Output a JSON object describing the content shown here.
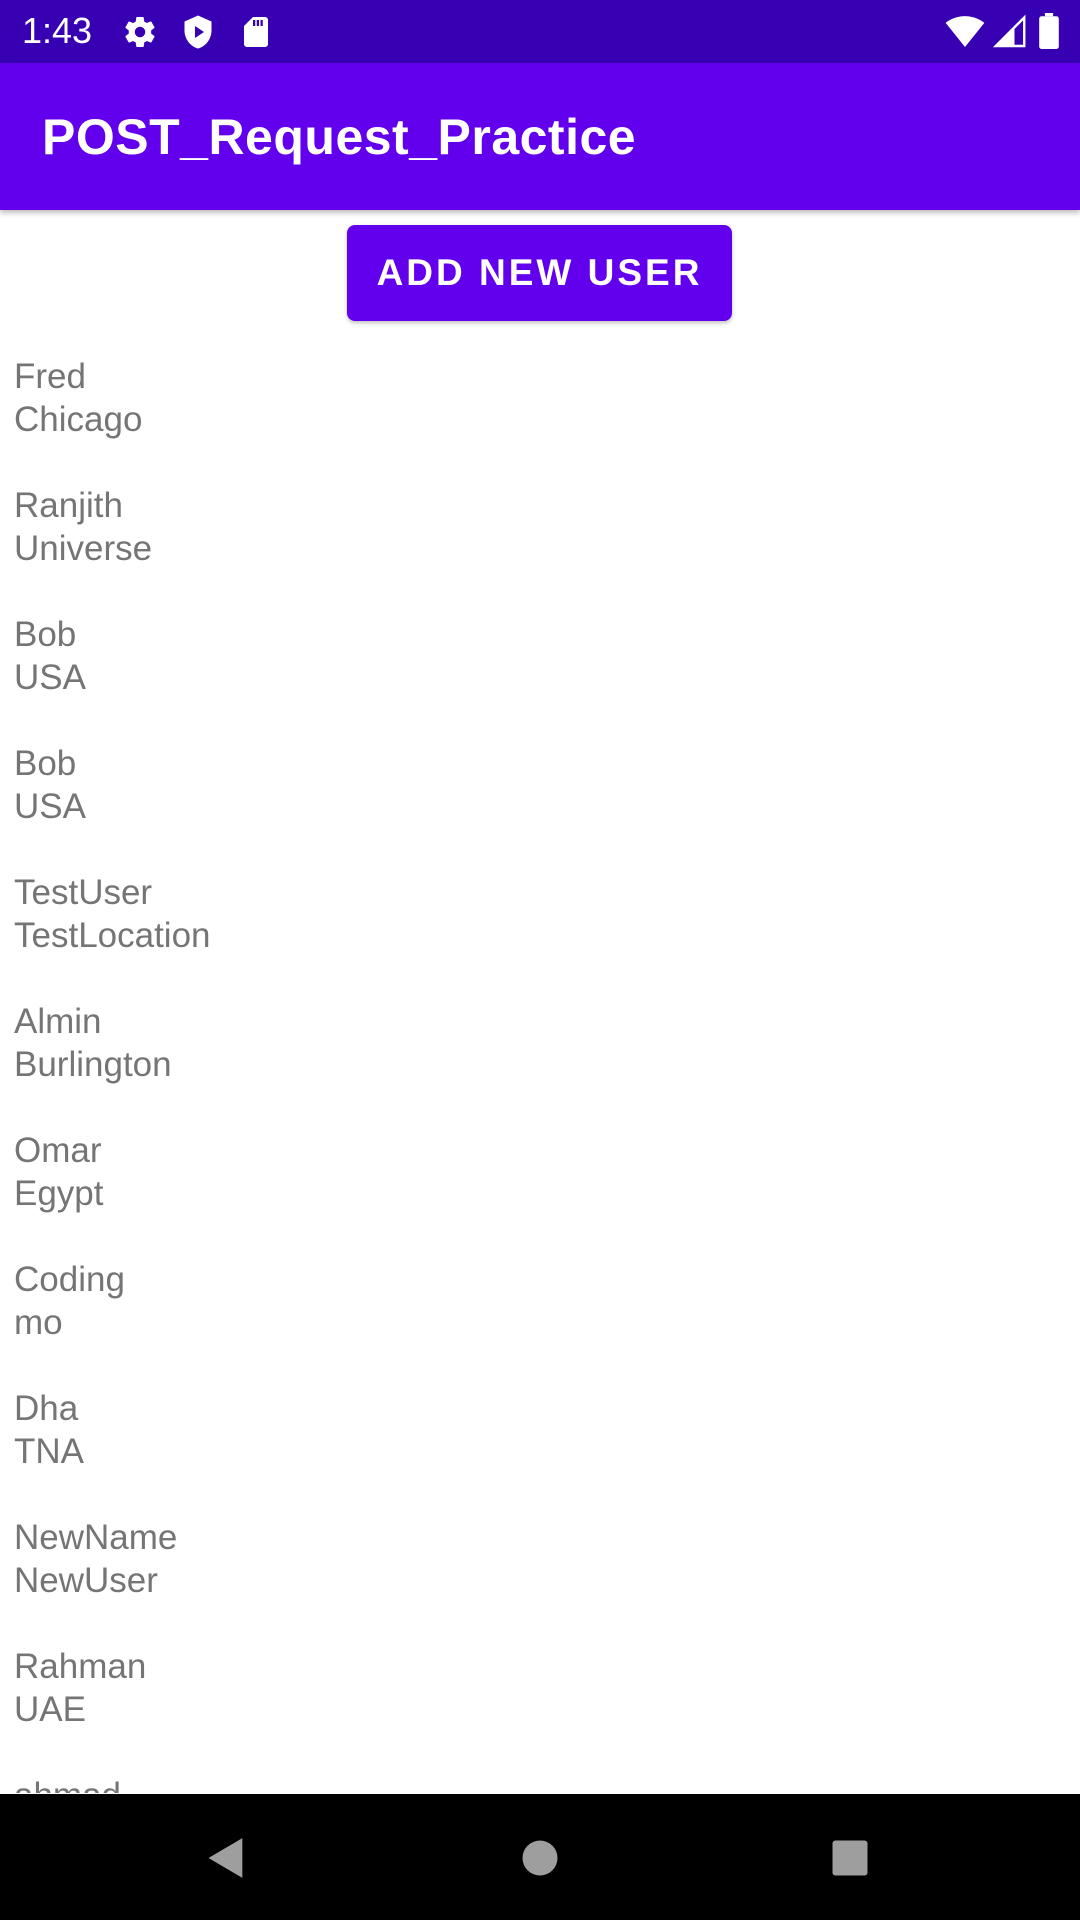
{
  "status_bar": {
    "time": "1:43",
    "icons": [
      "gear-icon",
      "shield-icon",
      "sd-card-icon",
      "wifi-icon",
      "signal-icon",
      "battery-icon"
    ]
  },
  "app_bar": {
    "title": "POST_Request_Practice",
    "color": "#6200ee"
  },
  "actions": {
    "add_user_label": "ADD NEW USER"
  },
  "users": [
    {
      "name": "Fred",
      "location": "Chicago"
    },
    {
      "name": "Ranjith",
      "location": "Universe"
    },
    {
      "name": "Bob",
      "location": "USA"
    },
    {
      "name": "Bob",
      "location": "USA"
    },
    {
      "name": "TestUser",
      "location": "TestLocation"
    },
    {
      "name": "Almin",
      "location": "Burlington"
    },
    {
      "name": "Omar",
      "location": "Egypt"
    },
    {
      "name": "Coding",
      "location": "mo"
    },
    {
      "name": "Dha",
      "location": "TNA"
    },
    {
      "name": "NewName",
      "location": "NewUser"
    },
    {
      "name": "Rahman",
      "location": "UAE"
    },
    {
      "name": "ahmad",
      "location": ""
    }
  ],
  "nav_bar": {
    "buttons": [
      "back-icon",
      "home-icon",
      "recent-apps-icon"
    ]
  },
  "colors": {
    "status_bar": "#3700b3",
    "primary": "#6200ee",
    "list_text": "#757575",
    "nav_bar": "#000000"
  }
}
